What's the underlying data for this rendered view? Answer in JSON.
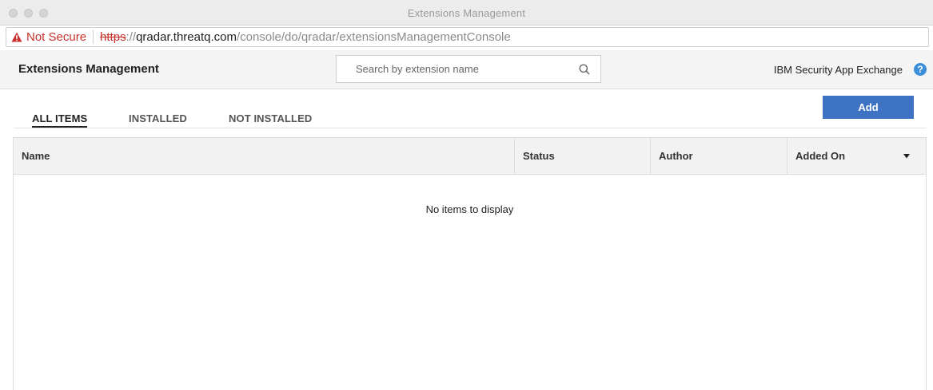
{
  "window": {
    "title": "Extensions Management"
  },
  "address_bar": {
    "security_label": "Not Secure",
    "scheme": "https",
    "scheme_suffix": "://",
    "host": "qradar.threatq.com",
    "path": "/console/do/qradar/extensionsManagementConsole"
  },
  "header": {
    "title": "Extensions Management",
    "search_placeholder": "Search by extension name",
    "exchange_link": "IBM Security App Exchange",
    "help_glyph": "?"
  },
  "tabs": [
    {
      "label": "ALL ITEMS",
      "active": true
    },
    {
      "label": "INSTALLED",
      "active": false
    },
    {
      "label": "NOT INSTALLED",
      "active": false
    }
  ],
  "toolbar": {
    "add_label": "Add"
  },
  "table": {
    "columns": [
      "Name",
      "Status",
      "Author",
      "Added On"
    ],
    "empty_message": "No items to display"
  },
  "colors": {
    "accent": "#3d73c2",
    "warning": "#c9302c",
    "help": "#3d8ed8"
  },
  "icons": {
    "address_warning": "warning-triangle-icon",
    "search": "search-icon",
    "help": "help-icon",
    "sort": "caret-down-icon"
  }
}
